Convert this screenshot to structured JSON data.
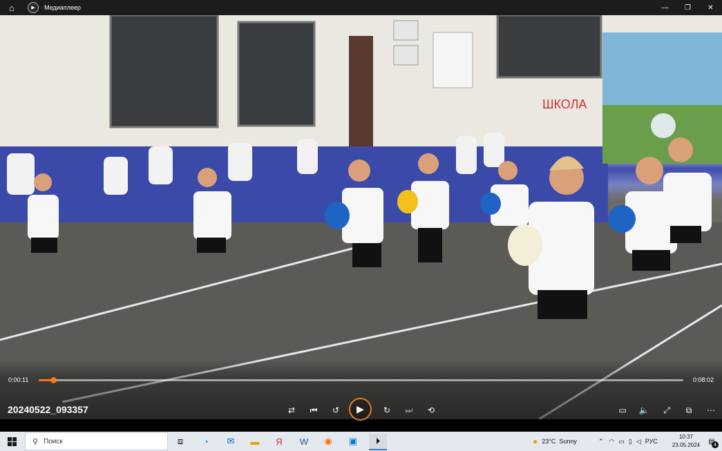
{
  "window": {
    "title": "Медиаплеер",
    "minimize_glyph": "—",
    "maximize_glyph": "❐",
    "close_glyph": "✕"
  },
  "player": {
    "current_time": "0:00:11",
    "total_time": "0:08:02",
    "progress_fraction": 0.023,
    "file_name": "20240522_093357",
    "accent_color": "#f47c20"
  },
  "taskbar": {
    "search_placeholder": "Поиск",
    "weather_temp": "23°C",
    "weather_text": "Sunny",
    "language": "РУС",
    "time": "10:37",
    "date": "23.05.2024",
    "notification_count": "4",
    "apps": [
      "task-view-icon",
      "edge-icon",
      "mail-icon",
      "file-explorer-icon",
      "yandex-browser-icon",
      "word-icon",
      "firefox-icon",
      "photos-icon",
      "media-player-icon"
    ]
  },
  "icons": {
    "home": "⌂",
    "shuffle": "⇄",
    "previous": "⏮",
    "rewind": "↺",
    "play": "▶",
    "forward": "↻",
    "next": "⏭",
    "repeat": "⟲",
    "subtitles": "▭",
    "volume": "🔈",
    "fullscreen": "⤢",
    "miniplayer": "⧉",
    "more": "⋯"
  }
}
